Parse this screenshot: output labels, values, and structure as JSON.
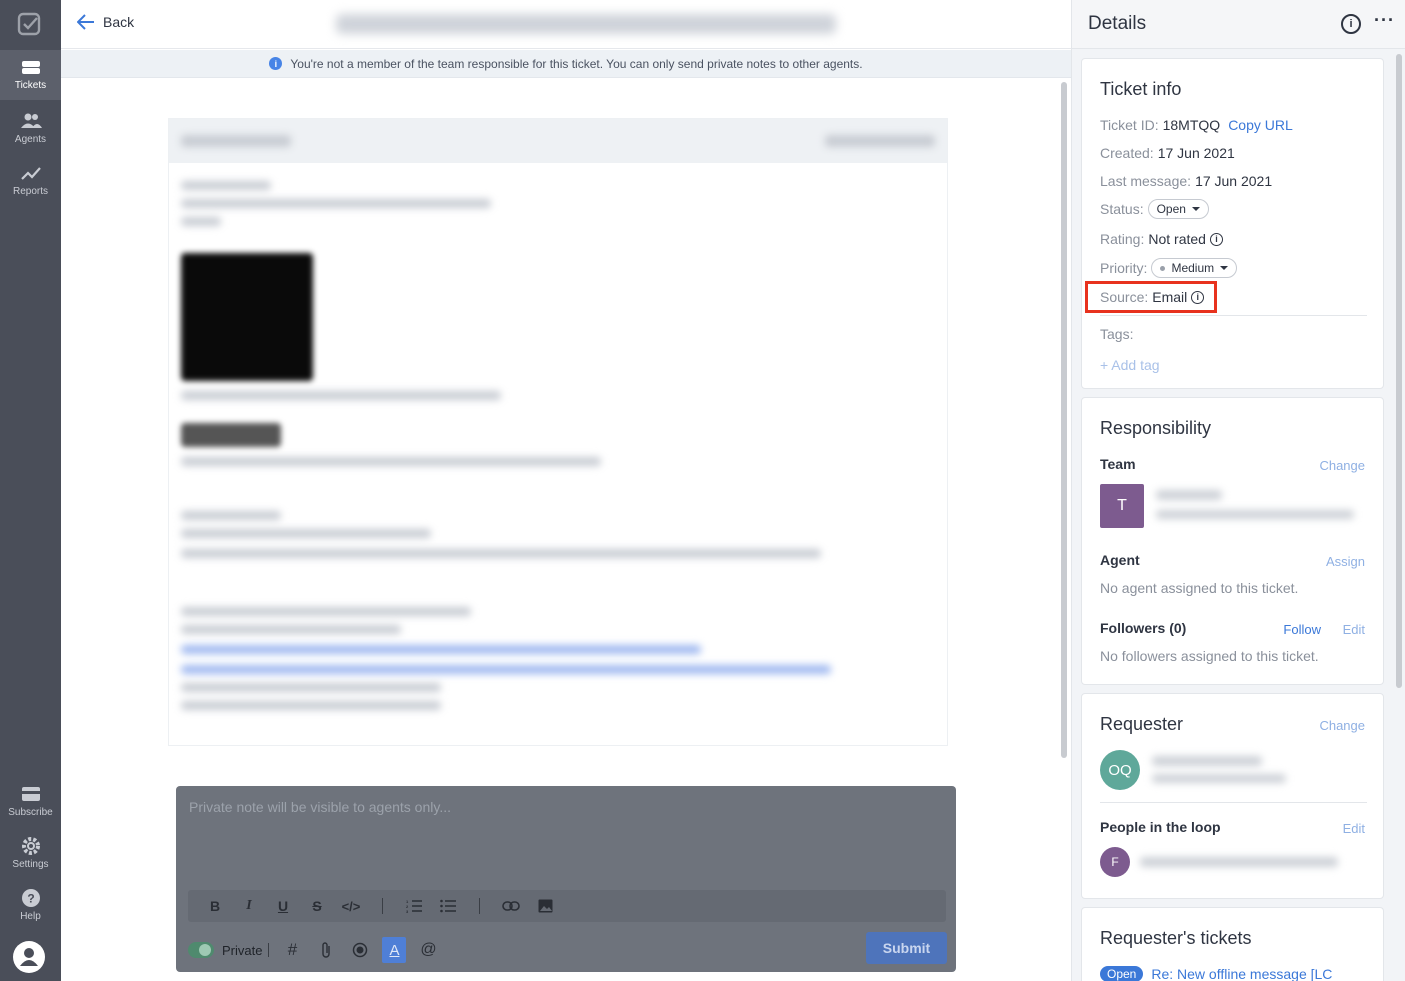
{
  "rail": {
    "items": [
      {
        "label": "Tickets",
        "icon": "tickets-icon"
      },
      {
        "label": "Agents",
        "icon": "agents-icon"
      },
      {
        "label": "Reports",
        "icon": "reports-icon"
      }
    ],
    "bottom_items": [
      {
        "label": "Subscribe",
        "icon": "subscribe-icon"
      },
      {
        "label": "Settings",
        "icon": "gear-icon"
      },
      {
        "label": "Help",
        "icon": "help-icon"
      }
    ]
  },
  "topbar": {
    "back_label": "Back"
  },
  "notice": {
    "text": "You're not a member of the team responsible for this ticket. You can only send private notes to other agents."
  },
  "editor": {
    "placeholder": "Private note will be visible to agents only...",
    "private_label": "Private",
    "submit_label": "Submit"
  },
  "details": {
    "title": "Details",
    "ticket_info": {
      "heading": "Ticket info",
      "ticket_id_label": "Ticket ID:",
      "ticket_id": "18MTQQ",
      "copy_url": "Copy URL",
      "created_label": "Created:",
      "created": "17 Jun 2021",
      "last_message_label": "Last message:",
      "last_message": "17 Jun 2021",
      "status_label": "Status:",
      "status": "Open",
      "rating_label": "Rating:",
      "rating": "Not rated",
      "priority_label": "Priority:",
      "priority": "Medium",
      "source_label": "Source:",
      "source": "Email",
      "tags_label": "Tags:",
      "add_tag": "+ Add tag"
    },
    "responsibility": {
      "heading": "Responsibility",
      "team_label": "Team",
      "team_change": "Change",
      "team_initial": "T",
      "agent_label": "Agent",
      "agent_assign": "Assign",
      "agent_none": "No agent assigned to this ticket.",
      "followers_label": "Followers (0)",
      "follow": "Follow",
      "followers_edit": "Edit",
      "followers_none": "No followers assigned to this ticket."
    },
    "requester": {
      "heading": "Requester",
      "change": "Change",
      "initials": "OQ",
      "people_label": "People in the loop",
      "people_edit": "Edit",
      "people_initial": "F"
    },
    "requester_tickets": {
      "heading": "Requester's tickets",
      "badge": "Open",
      "first_ticket": "Re: New offline message [LC"
    }
  },
  "colors": {
    "accent": "#3b78d8",
    "highlight": "#e8321e",
    "rail": "#4a4e59"
  }
}
